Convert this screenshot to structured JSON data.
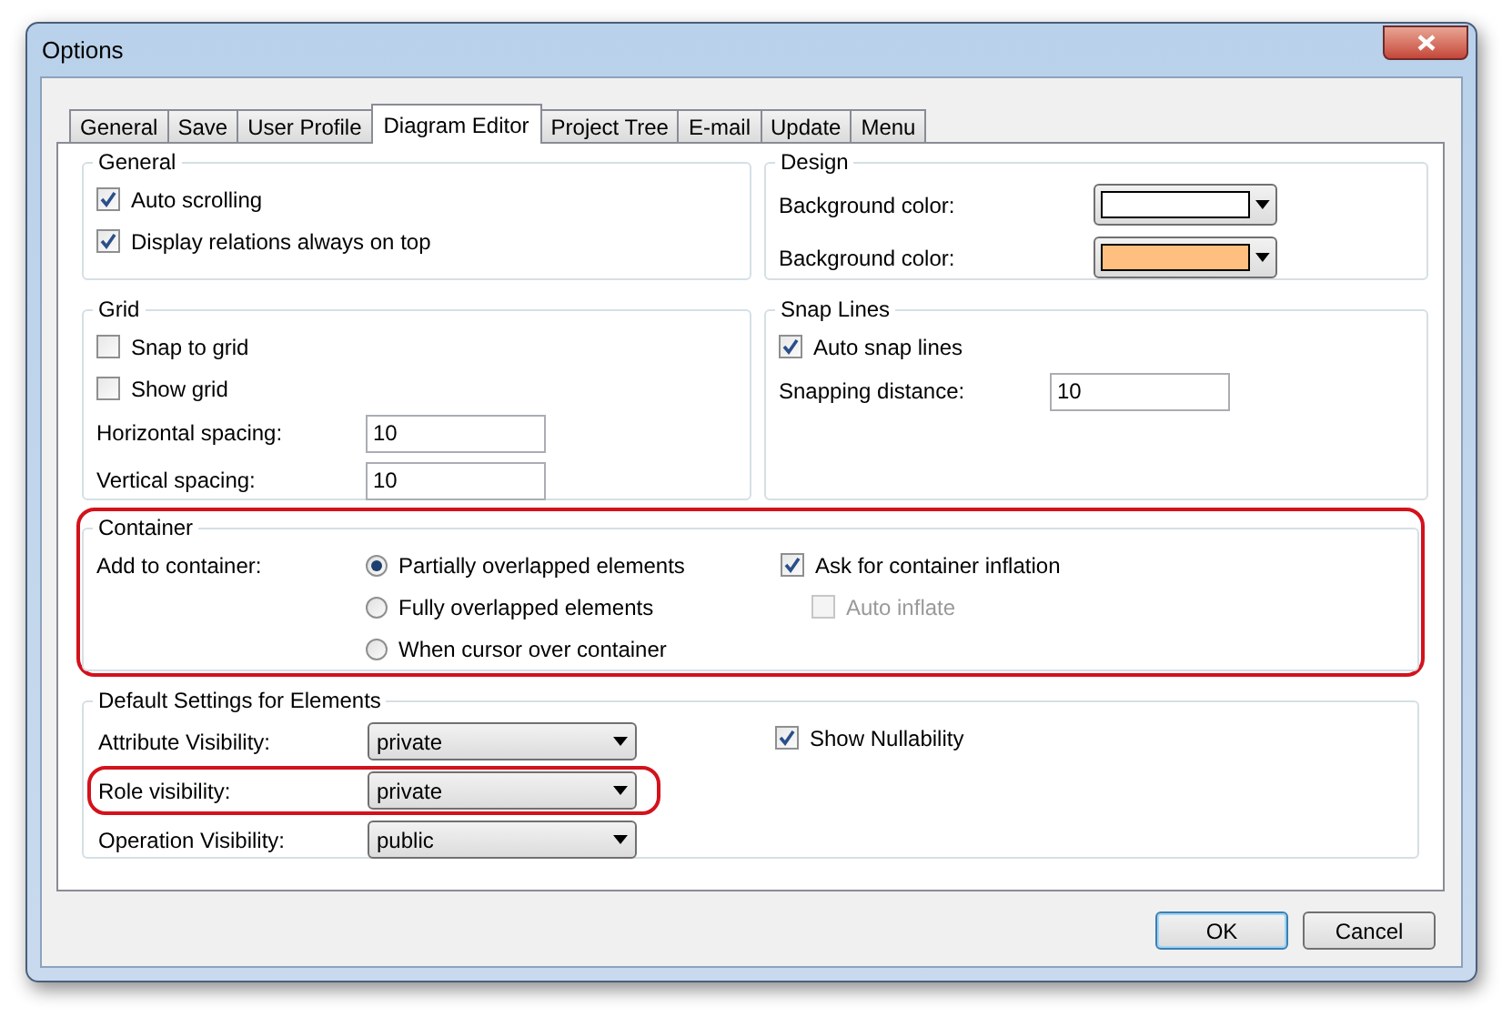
{
  "window": {
    "title": "Options"
  },
  "tabs": [
    {
      "label": "General",
      "selected": false
    },
    {
      "label": "Save",
      "selected": false
    },
    {
      "label": "User Profile",
      "selected": false
    },
    {
      "label": "Diagram Editor",
      "selected": true
    },
    {
      "label": "Project Tree",
      "selected": false
    },
    {
      "label": "E-mail",
      "selected": false
    },
    {
      "label": "Update",
      "selected": false
    },
    {
      "label": "Menu",
      "selected": false
    }
  ],
  "general": {
    "title": "General",
    "options": [
      {
        "label": "Auto scrolling",
        "checked": true
      },
      {
        "label": "Display relations always on top",
        "checked": true
      }
    ]
  },
  "design": {
    "title": "Design",
    "colors": [
      {
        "label": "Background color:",
        "color": "#ffffff"
      },
      {
        "label": "Background color:",
        "color": "#ffbf80"
      }
    ]
  },
  "grid": {
    "title": "Grid",
    "options": [
      {
        "label": "Snap to grid",
        "checked": false
      },
      {
        "label": "Show grid",
        "checked": false
      }
    ],
    "fields": [
      {
        "label": "Horizontal spacing:",
        "value": "10"
      },
      {
        "label": "Vertical spacing:",
        "value": "10"
      }
    ]
  },
  "snap_lines": {
    "title": "Snap Lines",
    "options": [
      {
        "label": "Auto snap lines",
        "checked": true
      }
    ],
    "fields": [
      {
        "label": "Snapping distance:",
        "value": "10"
      }
    ]
  },
  "container": {
    "title": "Container",
    "highlighted": true,
    "label": "Add to container:",
    "radios": [
      {
        "label": "Partially overlapped elements",
        "selected": true
      },
      {
        "label": "Fully overlapped elements",
        "selected": false
      },
      {
        "label": "When cursor over container",
        "selected": false
      }
    ],
    "options": [
      {
        "label": "Ask for container inflation",
        "checked": true,
        "disabled": false
      },
      {
        "label": "Auto inflate",
        "checked": false,
        "disabled": true
      }
    ]
  },
  "defaults": {
    "title": "Default Settings for Elements",
    "selects": [
      {
        "label": "Attribute Visibility:",
        "value": "private",
        "highlighted": false
      },
      {
        "label": "Role visibility:",
        "value": "private",
        "highlighted": true
      },
      {
        "label": "Operation Visibility:",
        "value": "public",
        "highlighted": false
      }
    ],
    "options": [
      {
        "label": "Show Nullability",
        "checked": true
      }
    ]
  },
  "buttons": [
    {
      "label": "OK",
      "default": true
    },
    {
      "label": "Cancel",
      "default": false
    }
  ]
}
